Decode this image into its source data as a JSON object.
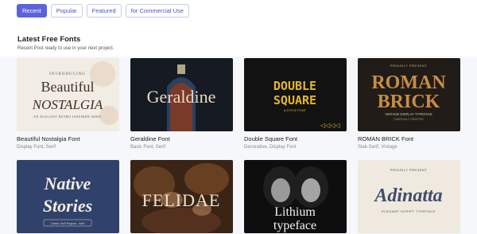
{
  "filters": {
    "recent": "Recent",
    "popular": "Popular",
    "featured": "Featured",
    "commercial": "for Commercial Use"
  },
  "section": {
    "title": "Latest Free Fonts",
    "subtitle": "Recent Post ready to use in your next project."
  },
  "fonts": [
    {
      "title": "Beautiful Nostalgia Font",
      "categories": "Display Font, Serif",
      "art": {
        "intro": "INTRODUCING",
        "line1": "Beautiful",
        "line2": "NOSTALGIA",
        "tagline": "AN ELEGANT RETRO INSPIRED SERIF"
      }
    },
    {
      "title": "Geraldine Font",
      "categories": "Basic Font, Serif",
      "art": {
        "word": "Geraldine"
      }
    },
    {
      "title": "Double Square Font",
      "categories": "Decorative, Display Font",
      "art": {
        "line1": "DOUBLE",
        "line2": "SQUARE",
        "tagline": "A STYLE FONT"
      }
    },
    {
      "title": "ROMAN BRICK Font",
      "categories": "Slab Serif, Vintage",
      "art": {
        "top": "PROUDLY PRESENT",
        "line1": "ROMAN",
        "line2": "BRICK",
        "tagline": "VINTAGE DISPLAY TYPEFACE",
        "sub": "CAREFULLY CRAFTED"
      }
    },
    {
      "title": "",
      "categories": "",
      "art": {
        "line1": "Native",
        "line2": "Stories",
        "tagline": "Classic Serif Regular - Italic"
      }
    },
    {
      "title": "",
      "categories": "",
      "art": {
        "word": "FELIDAE"
      }
    },
    {
      "title": "",
      "categories": "",
      "art": {
        "line1": "Lithium",
        "line2": "typeface"
      }
    },
    {
      "title": "",
      "categories": "",
      "art": {
        "top": "PROUDLY PRESENT",
        "word": "Adinatta",
        "tagline": "ELEGANT SCRIPT TYPEFACE"
      }
    }
  ]
}
